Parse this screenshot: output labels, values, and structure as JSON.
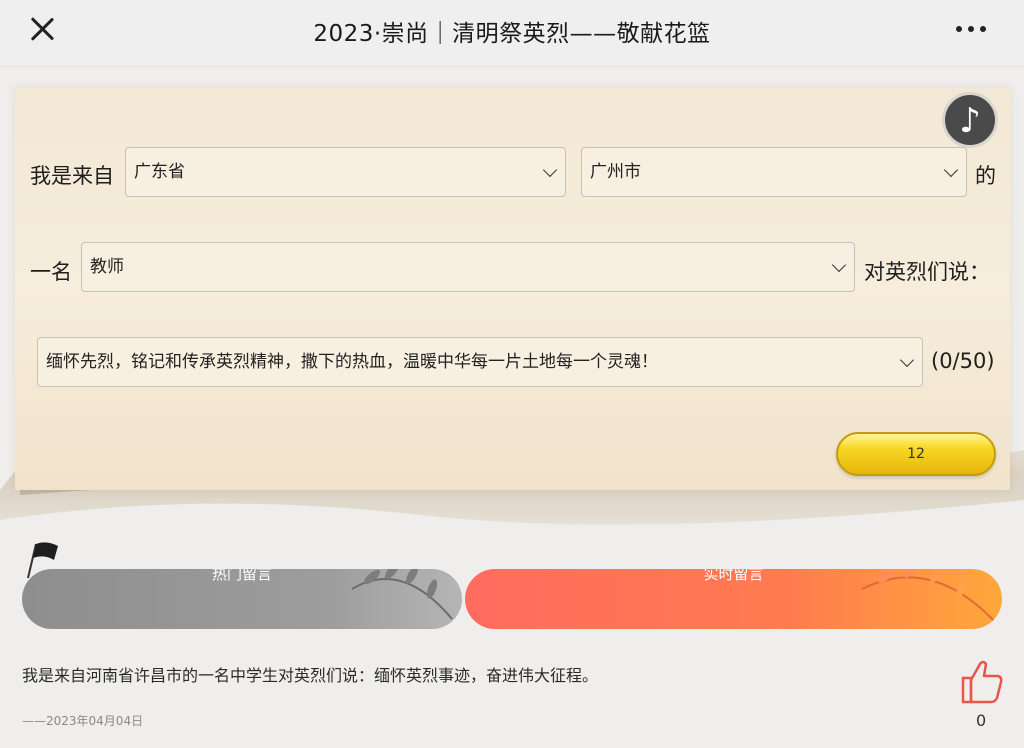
{
  "header": {
    "title": "2023·崇尚｜清明祭英烈——敬献花篮"
  },
  "form": {
    "prefix_label": "我是来自",
    "province_value": "广东省",
    "city_value": "广州市",
    "of_label": "的",
    "one_label": "一名",
    "role_value": "教师",
    "say_label": "对英烈们说：",
    "message_value": "缅怀先烈，铭记和传承英烈精神，撒下的热血，温暖中华每一片土地每一个灵魂！",
    "char_count": "(0/50)",
    "submit_label": "12"
  },
  "tabs": {
    "hot_label": "热门留言",
    "live_label": "实时留言"
  },
  "comment": {
    "text": "我是来自河南省许昌市的一名中学生对英烈们说：缅怀英烈事迹，奋进伟大征程。",
    "date": "——2023年04月04日",
    "likes": "0"
  },
  "colors": {
    "live_tab": "#ff6b5f",
    "hot_tab": "#9a9a9a",
    "submit_button": "#f7d823",
    "like_icon": "#e8564a"
  },
  "icons": {
    "close": "close-icon",
    "more": "more-dots-icon",
    "music": "music-note-icon",
    "like": "thumbs-up-icon",
    "flag": "flag-icon"
  }
}
